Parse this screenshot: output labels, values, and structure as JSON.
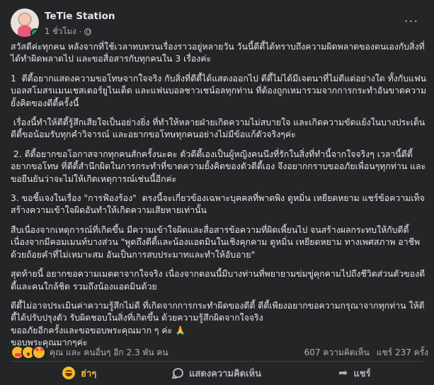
{
  "post": {
    "author": "TeTie Station",
    "time": "1 ชั่วโมง",
    "paragraphs": [
      "สวัสดีค่ะทุกคน หลังจากที่ใช้เวลาทบทวนเรื่องราวอยู่หลายวัน วันนี้ตีตี้ได้ทราบถึงความผิดพลาดของตนเองกับสิ่งที่ได้ทำผิดพลาดไป และขอสื่อสารกับทุกคนใน 3 เรื่องค่ะ",
      "1  ตีตี้อยากแสดงความขอโทษจากใจจริง กับสิ่งที่ตีตี้ได้แสดงออกไป ตีตี้ไม่ได้มีเจตนาที่ไม่ดีแต่อย่างใด ทั้งกับแฟนบอลสโมสรแมนเชสเตอร์ยูไนเต็ด และแฟนบอลชาวเชน์อลทุกท่าน ที่ต้องถูกเหมารวมจากการกระทำอันขาดความยั้งคิดของตีตี้ครั้งนี้",
      " เรื่องนี้ทำให้ตีตี้รู้สึกเสียใจเป็นอย่างยิ่ง ที่ทำให้หลายฝ่ายเกิดความไม่สบายใจ และเกิดความขัดแย้งในบางประเด็น ตีตี้ขอน้อมรับทุกคำวิจารณ์ และอยากขอโทษทุกคนอย่างไม่มีข้อแก้ตัวจริงๆค่ะ",
      " 2. ตีตี้อยากขอโอกาสจากทุกคนสักครั้งนะคะ ตัวตีตี้เองเป็นผู้หญิงคนนึงที่รักในสิ่งที่ทำนี้จากใจจริงๆ เวลานี้ตีตี้อยากขอโทษ ที่ตีตี้สำนึกผิดในการกระทำที่ขาดความยั้งคิดของตัวตีตี้เอง จึงอยากกราบขออภัยเพื่อนๆทุกท่าน และขอยืนยันว่าจะไม่ให้เกิดเหตุการณ์เช่นนี้อีกค่ะ",
      "3. ขอชี้แจงในเรื่อง \"การฟ้องร้อง\"  ตรงนี้จะเกี่ยวข้องเฉพาะบุคคลที่พาดพิง ดูหมิ่น เหยียดหยาม แชร์ข้อความเท็จ สร้างความเข้าใจผิดอันทำให้เกิดความเสียหายเท่านั้น",
      "สืบเนื่องจากเหตุการณ์ที่เกิดขึ้น มีความเข้าใจผิดและสื่อสารข้อความที่ผิดเพี้ยนไป จนสร้างผลกระทบให้กับตีตี้ เนื่องจากมีคอมเมนท์บางส่วน \"พูดถึงตีตี้และน้องแอดมินในเชิงคุกคาม ดูหมิ่น เหยียดหยาม ทางเพศสภาพ อาชีพ ด้วยถ้อยคำที่ไม่เหมาะสม อันเป็นการสบประมาทและทำให้อับอาย\"",
      "สุดท้ายนี้ อยากขอความเมตตาจากใจจริง เนื่องจากตอนนี้มีบางท่านที่พยายามข่มขู่คุกคามไปถึงชีวิตส่วนตัวของตีตี้และคนใกล้ชิด รวมถึงน้องแอดมินด้วย",
      "ตีตี้ไม่อาจประเมินค่าความรู้สึกไม่ดี ที่เกิดจากการกระทำผิดของตีตี้ ตีตี้เพียงอยากขอความกรุณาจากทุกท่าน ให้ตีตี้ได้ปรับปรุงตัว รับผิดชอบในสิ่งที่เกิดขึ้น ด้วยความรู้สึกผิดจากใจจริง\nขออภัยอีกครั้งและขอขอบพระคุณมาก ๆ ค่ะ 🙏\nขอบพระคุณมากๆค่ะ"
    ]
  },
  "stats": {
    "reactions_text": "คุณ และ คนอื่นๆ อีก 2.3 พัน คน",
    "comments": "607 ความคิดเห็น",
    "shares": "แชร์ 237 ครั้ง"
  },
  "actions": {
    "react_label": "ฮ่าๆ",
    "comment_label": "แสดงความคิดเห็น",
    "share_label": "แชร์"
  },
  "icons": {
    "reactions": [
      "care-icon",
      "wow-icon",
      "love-eyes-icon"
    ],
    "react": "haha-icon",
    "comment": "comment-icon",
    "share": "share-icon",
    "more": "more-options-icon",
    "audience": "globe-icon"
  },
  "colors": {
    "background": "#242526",
    "text": "#e4e6eb",
    "secondary": "#b0b3b8",
    "active_reaction": "#f7b928"
  }
}
